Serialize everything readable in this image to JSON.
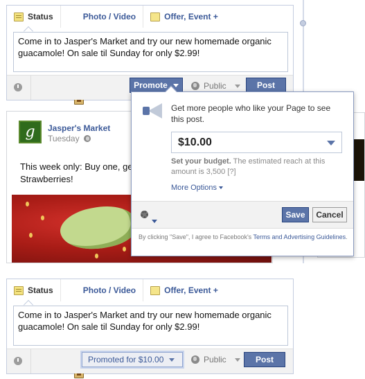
{
  "composer_tabs": {
    "status": "Status",
    "photo_video": "Photo / Video",
    "offer_event": "Offer, Event +"
  },
  "composer_text": "Come in to Jasper's Market and try our new homemade organic guacamole! On sale til Sunday for only $2.99!",
  "top_composer": {
    "promote_label": "Promote",
    "audience_label": "Public",
    "post_label": "Post"
  },
  "post": {
    "page_name": "Jasper's Market",
    "logo_letter": "g",
    "day": "Tuesday",
    "text": "This week only: Buy one, get one free on all California Strawberries!"
  },
  "promote_dropdown": {
    "description": "Get more people who like your Page to see this post.",
    "budget_value": "$10.00",
    "budget_note_bold": "Set your budget.",
    "budget_note_rest": "The estimated reach at this amount is 3,500",
    "help_marker": "[?]",
    "more_options": "More Options",
    "save_label": "Save",
    "cancel_label": "Cancel",
    "legal_prefix": "By clicking \"Save\", I agree to Facebook's",
    "legal_link": "Terms and Advertising Guidelines",
    "legal_suffix": "."
  },
  "bottom_composer": {
    "promoted_label": "Promoted for $10.00",
    "audience_label": "Public",
    "post_label": "Post"
  },
  "colors": {
    "link_blue": "#3b5998",
    "button_blue": "#5b74a8",
    "border": "#c4cde0"
  }
}
